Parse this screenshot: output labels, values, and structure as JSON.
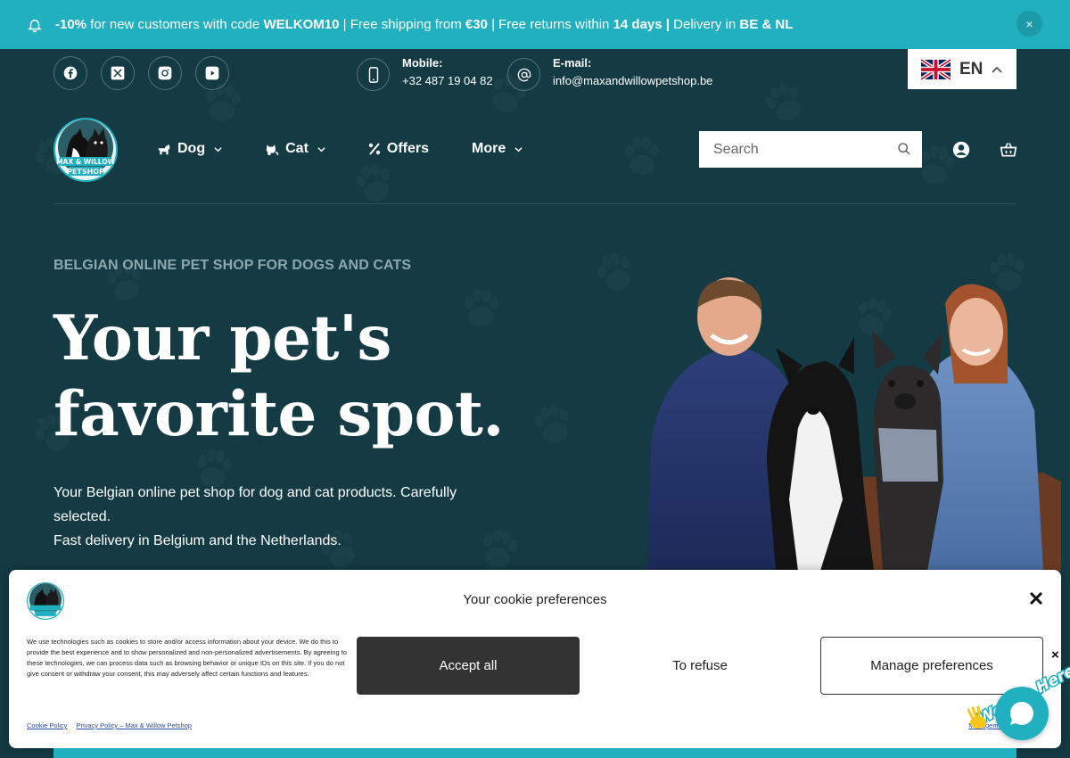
{
  "announcement": {
    "parts": [
      {
        "text": "-10%",
        "bold": true
      },
      {
        "text": " for new customers with code ",
        "bold": false
      },
      {
        "text": "WELKOM10",
        "bold": true
      },
      {
        "text": " | Free shipping from ",
        "bold": false
      },
      {
        "text": "€30",
        "bold": true
      },
      {
        "text": " | Free returns within ",
        "bold": false
      },
      {
        "text": "14 days",
        "bold": true
      },
      {
        "text": " | ",
        "bold": true
      },
      {
        "text": "Delivery in ",
        "bold": false
      },
      {
        "text": "BE & NL",
        "bold": true
      }
    ],
    "close_label": "×",
    "icon": "bell-icon"
  },
  "social": {
    "icons": [
      "facebook-icon",
      "x-twitter-icon",
      "instagram-icon",
      "youtube-icon"
    ]
  },
  "contact": {
    "mobile_label": "Mobile:",
    "mobile_value": "+32 487 19 04 82",
    "email_label": "E-mail:",
    "email_value": "info@maxandwillowpetshop.be"
  },
  "language": {
    "code": "EN",
    "flag": "uk-flag-icon"
  },
  "brand": {
    "logo_line1": "MAX & WILLOW",
    "logo_line2": "PETSHOP"
  },
  "nav": {
    "items": [
      {
        "label": "Dog",
        "icon": "dog-icon",
        "has_dropdown": true
      },
      {
        "label": "Cat",
        "icon": "cat-icon",
        "has_dropdown": true
      },
      {
        "label": "Offers",
        "icon": "percent-icon",
        "has_dropdown": false
      },
      {
        "label": "More",
        "icon": "",
        "has_dropdown": true
      }
    ]
  },
  "search": {
    "placeholder": "Search",
    "value": ""
  },
  "hero": {
    "eyebrow": "BELGIAN ONLINE PET SHOP FOR DOGS AND CATS",
    "headline_line1": "Your pet's",
    "headline_line2": "favorite spot.",
    "sub_line1": "Your Belgian online pet shop for dog and cat products. Carefully selected.",
    "sub_line2": "Fast delivery in Belgium and the Netherlands."
  },
  "cookie": {
    "title": "Your cookie preferences",
    "body": "We use technologies such as cookies to store and/or access information about your device. We do this to provide the best experience and to show personalized and non-personalized advertisements. By agreeing to these technologies, we can process data such as browsing behavior or unique IDs on this site. If you do not give consent or withdraw your consent, this may adversely affect certain functions and features.",
    "accept_label": "Accept all",
    "refuse_label": "To refuse",
    "manage_label": "Manage preferences",
    "link_cookie_policy": "Cookie Policy",
    "link_privacy_policy": "Privacy Policy – Max & Willow Petshop",
    "link_management": "Management"
  },
  "chat": {
    "label": "We Are Here!",
    "close_label": "×"
  },
  "colors": {
    "teal": "#20b0bf",
    "dark_bg": "#143a44",
    "white": "#ffffff"
  }
}
